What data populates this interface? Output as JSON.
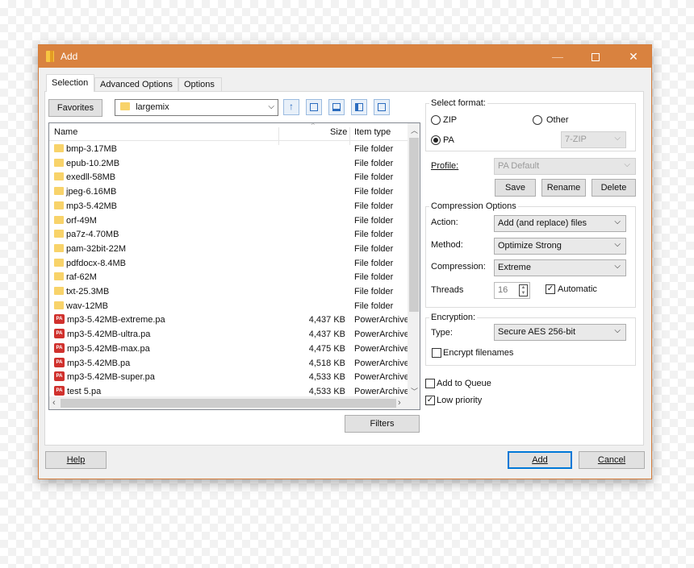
{
  "window": {
    "title": "Add",
    "minimize": "—",
    "maximize": "",
    "close": "✕"
  },
  "tabs": [
    "Selection",
    "Advanced Options",
    "Options"
  ],
  "toolbar": {
    "favorites": "Favorites",
    "path": "largemix"
  },
  "file_list": {
    "columns": {
      "name": "Name",
      "size": "Size",
      "type": "Item type"
    },
    "rows": [
      {
        "name": "bmp-3.17MB",
        "size": "",
        "type": "File folder",
        "kind": "folder"
      },
      {
        "name": "epub-10.2MB",
        "size": "",
        "type": "File folder",
        "kind": "folder"
      },
      {
        "name": "exedll-58MB",
        "size": "",
        "type": "File folder",
        "kind": "folder"
      },
      {
        "name": "jpeg-6.16MB",
        "size": "",
        "type": "File folder",
        "kind": "folder"
      },
      {
        "name": "mp3-5.42MB",
        "size": "",
        "type": "File folder",
        "kind": "folder"
      },
      {
        "name": "orf-49M",
        "size": "",
        "type": "File folder",
        "kind": "folder"
      },
      {
        "name": "pa7z-4.70MB",
        "size": "",
        "type": "File folder",
        "kind": "folder"
      },
      {
        "name": "pam-32bit-22M",
        "size": "",
        "type": "File folder",
        "kind": "folder"
      },
      {
        "name": "pdfdocx-8.4MB",
        "size": "",
        "type": "File folder",
        "kind": "folder"
      },
      {
        "name": "raf-62M",
        "size": "",
        "type": "File folder",
        "kind": "folder"
      },
      {
        "name": "txt-25.3MB",
        "size": "",
        "type": "File folder",
        "kind": "folder"
      },
      {
        "name": "wav-12MB",
        "size": "",
        "type": "File folder",
        "kind": "folder"
      },
      {
        "name": "mp3-5.42MB-extreme.pa",
        "size": "4,437 KB",
        "type": "PowerArchive",
        "kind": "pa"
      },
      {
        "name": "mp3-5.42MB-ultra.pa",
        "size": "4,437 KB",
        "type": "PowerArchive",
        "kind": "pa"
      },
      {
        "name": "mp3-5.42MB-max.pa",
        "size": "4,475 KB",
        "type": "PowerArchive",
        "kind": "pa"
      },
      {
        "name": "mp3-5.42MB.pa",
        "size": "4,518 KB",
        "type": "PowerArchive",
        "kind": "pa"
      },
      {
        "name": "mp3-5.42MB-super.pa",
        "size": "4,533 KB",
        "type": "PowerArchive",
        "kind": "pa"
      },
      {
        "name": "test 5.pa",
        "size": "4,533 KB",
        "type": "PowerArchive",
        "kind": "pa"
      }
    ],
    "pa_icon_text": "PA"
  },
  "filters_button": "Filters",
  "format": {
    "title": "Select format:",
    "zip": "ZIP",
    "other": "Other",
    "pa": "PA",
    "selected": "PA",
    "other_combo": "7-ZIP"
  },
  "profile": {
    "label": "Profile:",
    "value": "PA Default",
    "save": "Save",
    "rename": "Rename",
    "delete": "Delete"
  },
  "compression": {
    "title": "Compression Options",
    "action_label": "Action:",
    "action": "Add (and replace) files",
    "method_label": "Method:",
    "method": "Optimize Strong",
    "compression_label": "Compression:",
    "compression": "Extreme",
    "threads_label": "Threads",
    "threads": "16",
    "automatic": "Automatic",
    "automatic_checked": true
  },
  "encryption": {
    "title": "Encryption:",
    "type_label": "Type:",
    "type": "Secure AES 256-bit",
    "encrypt_filenames": "Encrypt filenames",
    "encrypt_filenames_checked": false
  },
  "add_to_queue": {
    "label": "Add to Queue",
    "checked": false
  },
  "low_priority": {
    "label": "Low priority",
    "checked": true
  },
  "footer": {
    "help": "Help",
    "add": "Add",
    "cancel": "Cancel"
  },
  "icons": [
    "up-folder-icon",
    "new-folder-icon",
    "view-icon",
    "details-view-icon",
    "list-view-icon"
  ]
}
